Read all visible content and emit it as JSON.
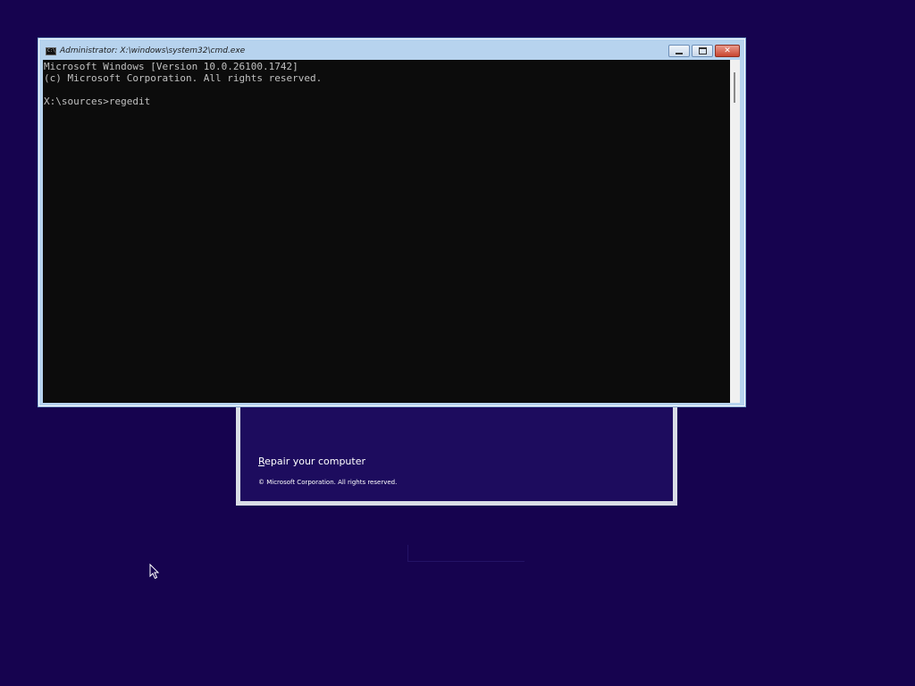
{
  "console": {
    "title": "Administrator: X:\\windows\\system32\\cmd.exe",
    "icon": "cmd-icon",
    "icon_text": "C:\\",
    "lines": [
      "Microsoft Windows [Version 10.0.26100.1742]",
      "(c) Microsoft Corporation. All rights reserved.",
      "",
      "X:\\sources>regedit"
    ],
    "buttons": {
      "minimize": "minimize-icon",
      "maximize": "maximize-icon",
      "close": "close-icon",
      "close_glyph": "✕"
    }
  },
  "setup": {
    "repair_accel": "R",
    "repair_rest": "epair your computer",
    "copyright": "© Microsoft Corporation. All rights reserved."
  },
  "colors": {
    "desktop_bg": "#16034f",
    "console_bg": "#0c0c0c",
    "console_fg": "#c0c0c0",
    "frame": "#b7d3ee"
  },
  "cursor": "pointer-cursor-icon"
}
